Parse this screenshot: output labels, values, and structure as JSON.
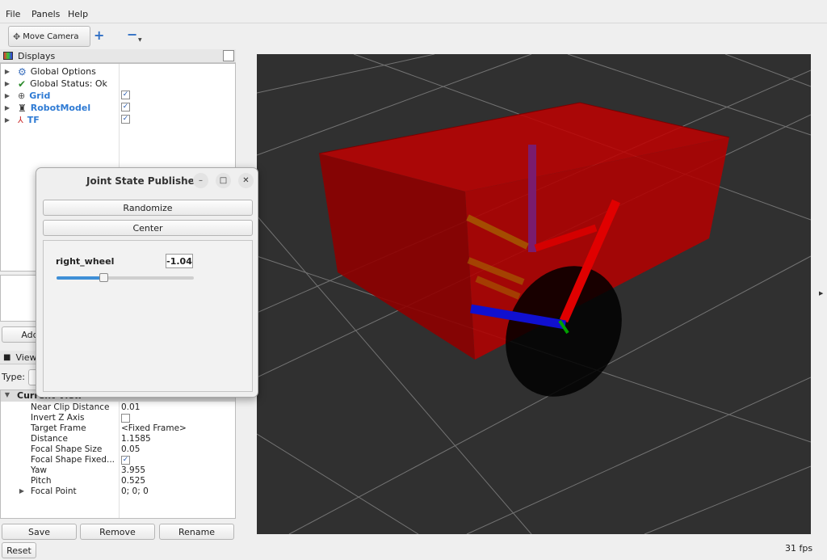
{
  "menu": {
    "file": "File",
    "panels": "Panels",
    "help": "Help"
  },
  "toolbar": {
    "move_camera": "Move Camera"
  },
  "displays": {
    "title": "Displays",
    "items": [
      {
        "label": "Global Options"
      },
      {
        "label": "Global Status: Ok"
      },
      {
        "label": "Grid",
        "checked": true
      },
      {
        "label": "RobotModel",
        "checked": true
      },
      {
        "label": "TF",
        "checked": true
      }
    ],
    "add_button": "Add"
  },
  "views": {
    "title": "Views",
    "type_label": "Type:",
    "current_view": "Current View",
    "properties": [
      {
        "key": "Near Clip Distance",
        "value": "0.01"
      },
      {
        "key": "Invert Z Axis",
        "value": "",
        "checkbox": true,
        "checked": false
      },
      {
        "key": "Target Frame",
        "value": "<Fixed Frame>"
      },
      {
        "key": "Distance",
        "value": "1.1585"
      },
      {
        "key": "Focal Shape Size",
        "value": "0.05"
      },
      {
        "key": "Focal Shape Fixed...",
        "value": "",
        "checkbox": true,
        "checked": true
      },
      {
        "key": "Yaw",
        "value": "3.955"
      },
      {
        "key": "Pitch",
        "value": "0.525"
      },
      {
        "key": "Focal Point",
        "value": "0; 0; 0"
      }
    ],
    "save": "Save",
    "remove": "Remove",
    "rename": "Rename"
  },
  "joint_state_publisher": {
    "title": "Joint State Publisher",
    "randomize": "Randomize",
    "center": "Center",
    "joint_name": "right_wheel",
    "joint_value": "-1.04",
    "slider_fraction": 0.34
  },
  "status": {
    "reset": "Reset",
    "fps": "31 fps"
  },
  "colors": {
    "accent": "#2f7bd4",
    "viewport_bg": "#303030",
    "box": "#b00000"
  }
}
